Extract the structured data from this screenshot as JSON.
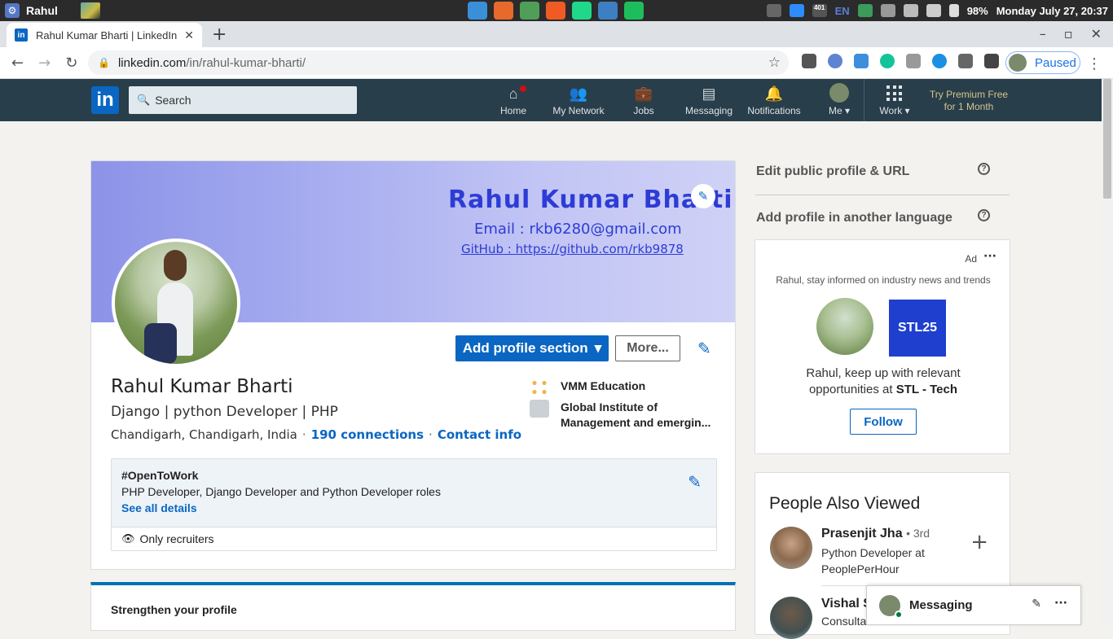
{
  "os": {
    "user": "Rahul",
    "battery": "98%",
    "datetime": "Monday July 27, 20:37",
    "lang": "EN",
    "app_badge": "401"
  },
  "browser": {
    "tab_title": "Rahul Kumar Bharti | LinkedIn",
    "url_host": "linkedin.com",
    "url_path": "/in/rahul-kumar-bharti/",
    "profile_status": "Paused"
  },
  "linkedin_nav": {
    "logo": "in",
    "search_placeholder": "Search",
    "items": [
      {
        "label": "Home",
        "icon": "home-icon"
      },
      {
        "label": "My Network",
        "icon": "network-icon"
      },
      {
        "label": "Jobs",
        "icon": "briefcase-icon"
      },
      {
        "label": "Messaging",
        "icon": "messaging-icon"
      },
      {
        "label": "Notifications",
        "icon": "bell-icon"
      }
    ],
    "me_label": "Me",
    "work_label": "Work",
    "premium_line1": "Try Premium Free",
    "premium_line2": "for 1 Month"
  },
  "profile": {
    "banner_name": "Rahul Kumar Bharti",
    "banner_email": "Email : rkb6280@gmail.com",
    "banner_github": "GitHub : https://github.com/rkb9878",
    "add_section_label": "Add profile section",
    "more_label": "More...",
    "name": "Rahul Kumar Bharti",
    "headline": "Django | python Developer | PHP",
    "location": "Chandigarh, Chandigarh, India",
    "connections": "190 connections",
    "contact": "Contact info",
    "experience": [
      {
        "name": "VMM Education"
      },
      {
        "name_line1": "Global Institute of",
        "name_line2": "Management and emergin..."
      }
    ],
    "open_to_work": {
      "title": "#OpenToWork",
      "roles": "PHP Developer, Django Developer and Python Developer roles",
      "see_all": "See all details",
      "visibility": "Only recruiters"
    }
  },
  "strengthen": {
    "title": "Strengthen your profile"
  },
  "sidebar": {
    "edit_public": "Edit public profile & URL",
    "add_language": "Add profile in another language",
    "ad": {
      "label": "Ad",
      "subtitle": "Rahul, stay informed on industry news and trends",
      "logo_text": "STL25",
      "line1": "Rahul, keep up with relevant",
      "line2_prefix": "opportunities at ",
      "company": "STL - Tech",
      "follow": "Follow"
    },
    "people_also_viewed": {
      "title": "People Also Viewed",
      "people": [
        {
          "name": "Prasenjit Jha",
          "degree": "• 3rd",
          "job": "Python Developer at PeoplePerHour"
        },
        {
          "name": "Vishal S",
          "job": "Consulta"
        }
      ]
    }
  },
  "messaging": {
    "title": "Messaging"
  }
}
